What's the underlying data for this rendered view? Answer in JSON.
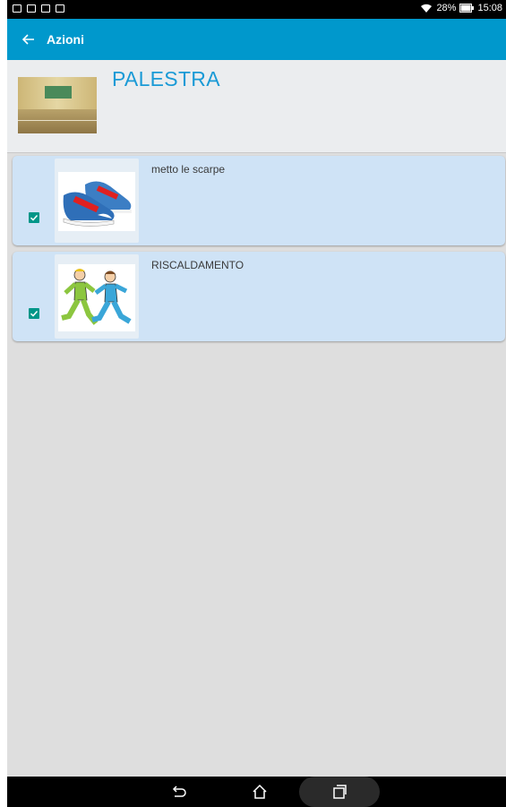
{
  "status_bar": {
    "battery_percent": "28%",
    "time": "15:08",
    "notification_icons": [
      "notification-icon",
      "gallery-icon",
      "message-icon",
      "calendar-icon"
    ]
  },
  "toolbar": {
    "back_icon": "arrow-left-icon",
    "title": "Azioni"
  },
  "header": {
    "title": "PALESTRA",
    "image": "gym-photo"
  },
  "actions": [
    {
      "label": "metto le scarpe",
      "checked": true,
      "image": "sneakers-picture"
    },
    {
      "label": "RISCALDAMENTO",
      "checked": true,
      "image": "running-children-picture"
    }
  ],
  "nav_bar": {
    "back_icon": "nav-back-icon",
    "home_icon": "nav-home-icon",
    "recent_icon": "nav-recent-apps-icon"
  },
  "colors": {
    "toolbar": "#0098cc",
    "title": "#1a9ad6",
    "card": "#cfe3f6",
    "checkbox": "#009688",
    "background": "#dedede"
  }
}
